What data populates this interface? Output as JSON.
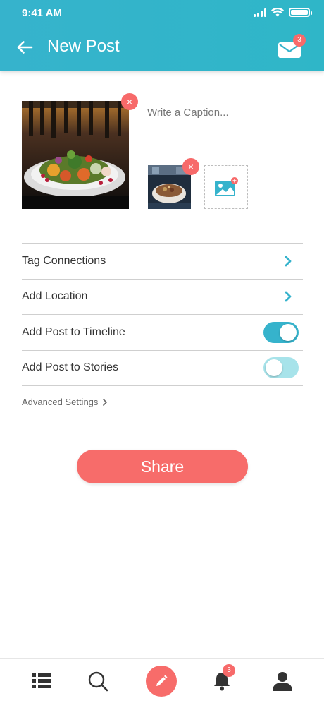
{
  "status_bar": {
    "time": "9:41 AM"
  },
  "header": {
    "title": "New Post",
    "mail_badge": "3"
  },
  "composer": {
    "caption_placeholder": "Write a Caption...",
    "remove_symbol": "×"
  },
  "settings": {
    "rows": [
      {
        "label": "Tag Connections",
        "control": "chevron"
      },
      {
        "label": "Add Location",
        "control": "chevron"
      },
      {
        "label": "Add Post to Timeline",
        "control": "toggle",
        "on": true
      },
      {
        "label": "Add Post to Stories",
        "control": "toggle",
        "on": false
      }
    ],
    "advanced_label": "Advanced Settings"
  },
  "share_label": "Share",
  "tabbar": {
    "items": [
      "feed-icon",
      "search-icon",
      "compose-icon",
      "bell-icon",
      "profile-icon"
    ],
    "notification_badge": "3"
  },
  "colors": {
    "accent": "#36b3cc",
    "coral": "#f76c6a",
    "toggle_off": "#a7e3ea"
  }
}
